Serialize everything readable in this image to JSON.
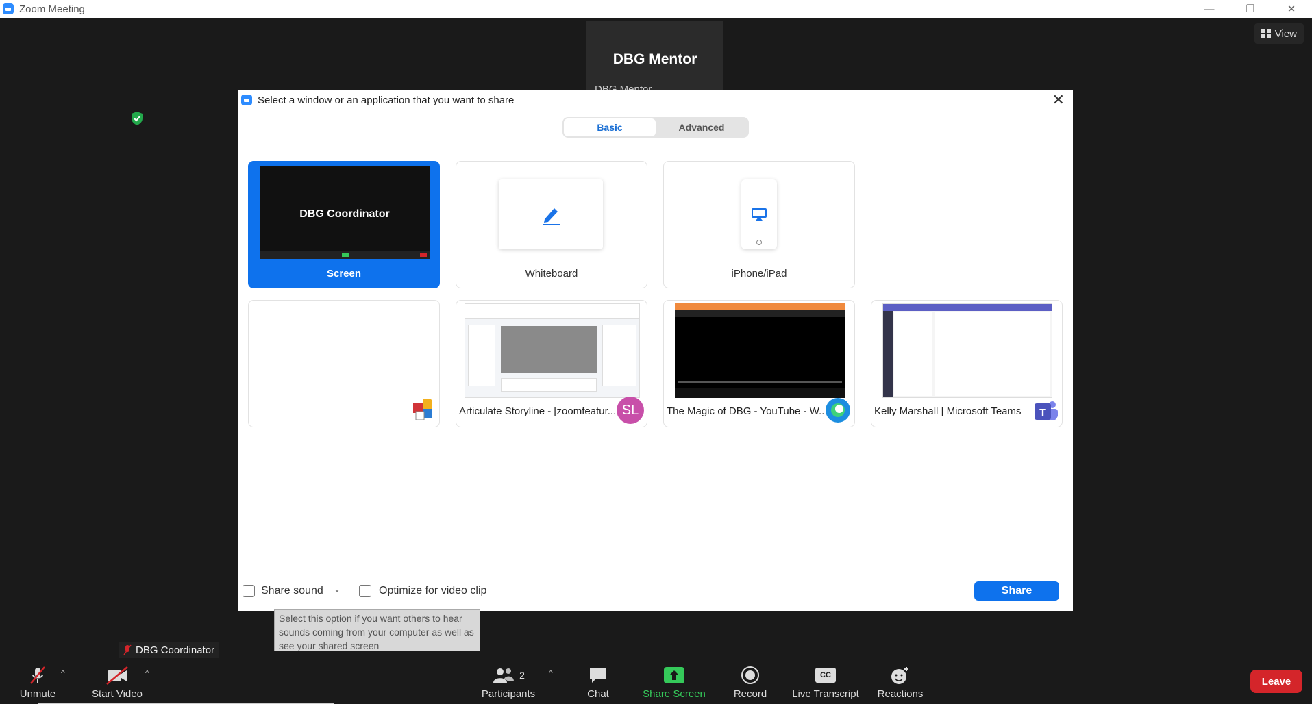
{
  "window": {
    "title": "Zoom Meeting",
    "minimize": "—",
    "restore": "❐",
    "close": "✕"
  },
  "meeting": {
    "speaker_name": "DBG Mentor",
    "speaker_sub": "DBG Mentor",
    "view_label": "View",
    "self_name": "DBG Coordinator"
  },
  "dialog": {
    "title": "Select a window or an application that you want to share",
    "close": "✕",
    "tabs": [
      {
        "label": "Basic"
      },
      {
        "label": "Advanced"
      }
    ],
    "options": [
      {
        "label": "Screen",
        "thumb_title": "DBG Coordinator"
      },
      {
        "label": "Whiteboard"
      },
      {
        "label": "iPhone/iPad"
      }
    ],
    "windows": [
      {
        "label": ""
      },
      {
        "label": "Articulate Storyline - [zoomfeatur...",
        "badge": "SL"
      },
      {
        "label": "The Magic of DBG - YouTube - W..."
      },
      {
        "label": "Kelly Marshall | Microsoft Teams"
      }
    ],
    "share_sound": "Share sound",
    "optimize": "Optimize for video clip",
    "share_button": "Share",
    "tooltip": "Select this option if you want others to hear sounds coming from your computer as well as see your shared screen"
  },
  "toolbar": {
    "unmute": "Unmute",
    "start_video": "Start Video",
    "participants": "Participants",
    "participant_count": "2",
    "chat": "Chat",
    "share_screen": "Share Screen",
    "record": "Record",
    "live_transcript": "Live Transcript",
    "cc": "CC",
    "reactions": "Reactions",
    "leave": "Leave"
  }
}
